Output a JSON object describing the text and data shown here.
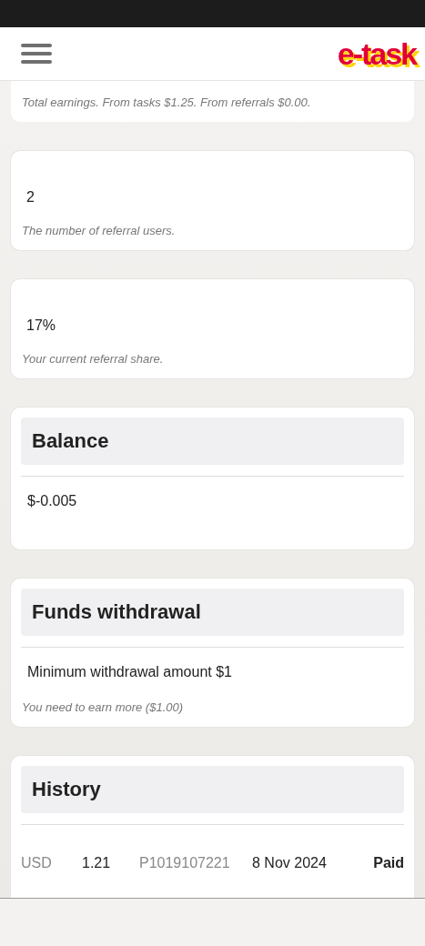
{
  "header": {
    "logo": "e-task"
  },
  "stats": [
    {
      "caption": "Total earnings.  From tasks $1.25.  From referrals $0.00."
    },
    {
      "value": "2",
      "caption": "The number of referral users."
    },
    {
      "value": "17%",
      "caption": "Your current referral share."
    }
  ],
  "balance": {
    "title": "Balance",
    "amount": "$-0.005"
  },
  "withdrawal": {
    "title": "Funds withdrawal",
    "minimum": "Minimum withdrawal amount $1",
    "note": "You need to earn more ($1.00)"
  },
  "history": {
    "title": "History",
    "rows": [
      {
        "currency": "USD",
        "amount": "1.21",
        "id": "P1019107221",
        "date": "8 Nov 2024",
        "status": "Paid"
      }
    ]
  }
}
